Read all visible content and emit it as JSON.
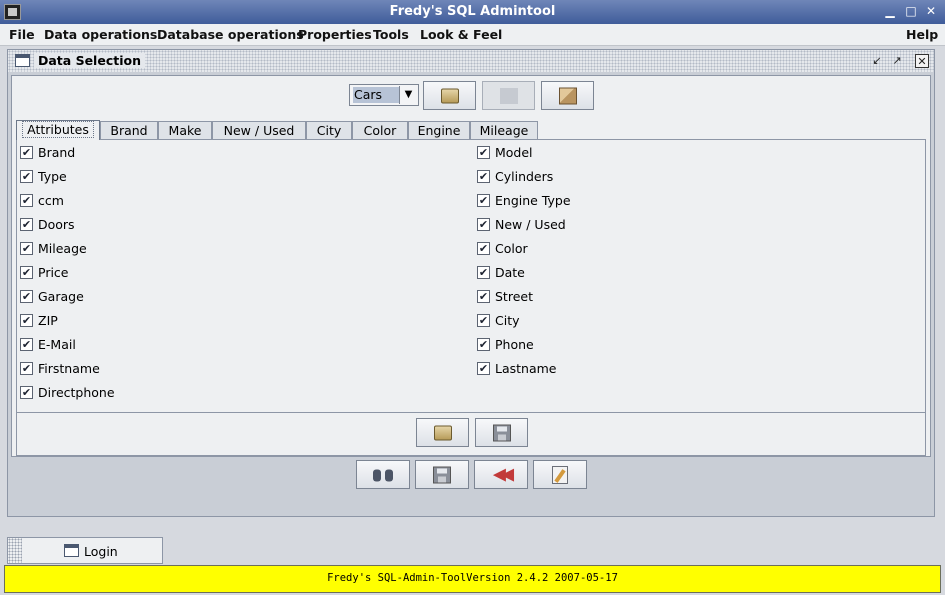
{
  "window": {
    "title": "Fredy's SQL Admintool"
  },
  "menubar": {
    "items": [
      "File",
      "Data operations",
      "Database operations",
      "Properties",
      "Tools",
      "Look & Feel",
      "Help"
    ]
  },
  "frame": {
    "title": "Data Selection",
    "controls": [
      "restore-icon",
      "maximize-icon",
      "close-icon"
    ]
  },
  "toolbar": {
    "table_select": {
      "value": "Cars"
    },
    "buttons": [
      {
        "icon": "open-folder-icon",
        "enabled": true
      },
      {
        "icon": "blank-icon",
        "enabled": false
      },
      {
        "icon": "package-icon",
        "enabled": true
      }
    ]
  },
  "tabs": [
    "Attributes",
    "Brand",
    "Make",
    "New / Used",
    "City",
    "Color",
    "Engine",
    "Mileage"
  ],
  "active_tab": "Attributes",
  "attributes": {
    "left": [
      {
        "label": "Brand",
        "checked": true
      },
      {
        "label": "Type",
        "checked": true
      },
      {
        "label": "ccm",
        "checked": true
      },
      {
        "label": "Doors",
        "checked": true
      },
      {
        "label": "Mileage",
        "checked": true
      },
      {
        "label": "Price",
        "checked": true
      },
      {
        "label": "Garage",
        "checked": true
      },
      {
        "label": "ZIP",
        "checked": true
      },
      {
        "label": "E-Mail",
        "checked": true
      },
      {
        "label": "Firstname",
        "checked": true
      },
      {
        "label": "Directphone",
        "checked": true
      }
    ],
    "right": [
      {
        "label": "Model",
        "checked": true
      },
      {
        "label": "Cylinders",
        "checked": true
      },
      {
        "label": "Engine Type",
        "checked": true
      },
      {
        "label": "New / Used",
        "checked": true
      },
      {
        "label": "Color",
        "checked": true
      },
      {
        "label": "Date",
        "checked": true
      },
      {
        "label": "Street",
        "checked": true
      },
      {
        "label": "City",
        "checked": true
      },
      {
        "label": "Phone",
        "checked": true
      },
      {
        "label": "Lastname",
        "checked": true
      }
    ]
  },
  "panel_buttons": [
    {
      "icon": "open-folder-icon"
    },
    {
      "icon": "save-disk-icon"
    }
  ],
  "bottom_buttons": [
    {
      "icon": "binoculars-icon"
    },
    {
      "icon": "save-disk-icon"
    },
    {
      "icon": "rewind-icon"
    },
    {
      "icon": "edit-document-icon"
    }
  ],
  "login_tab": {
    "label": "Login"
  },
  "status": {
    "text": "Fredy's SQL-Admin-ToolVersion 2.4.2 2007-05-17"
  }
}
